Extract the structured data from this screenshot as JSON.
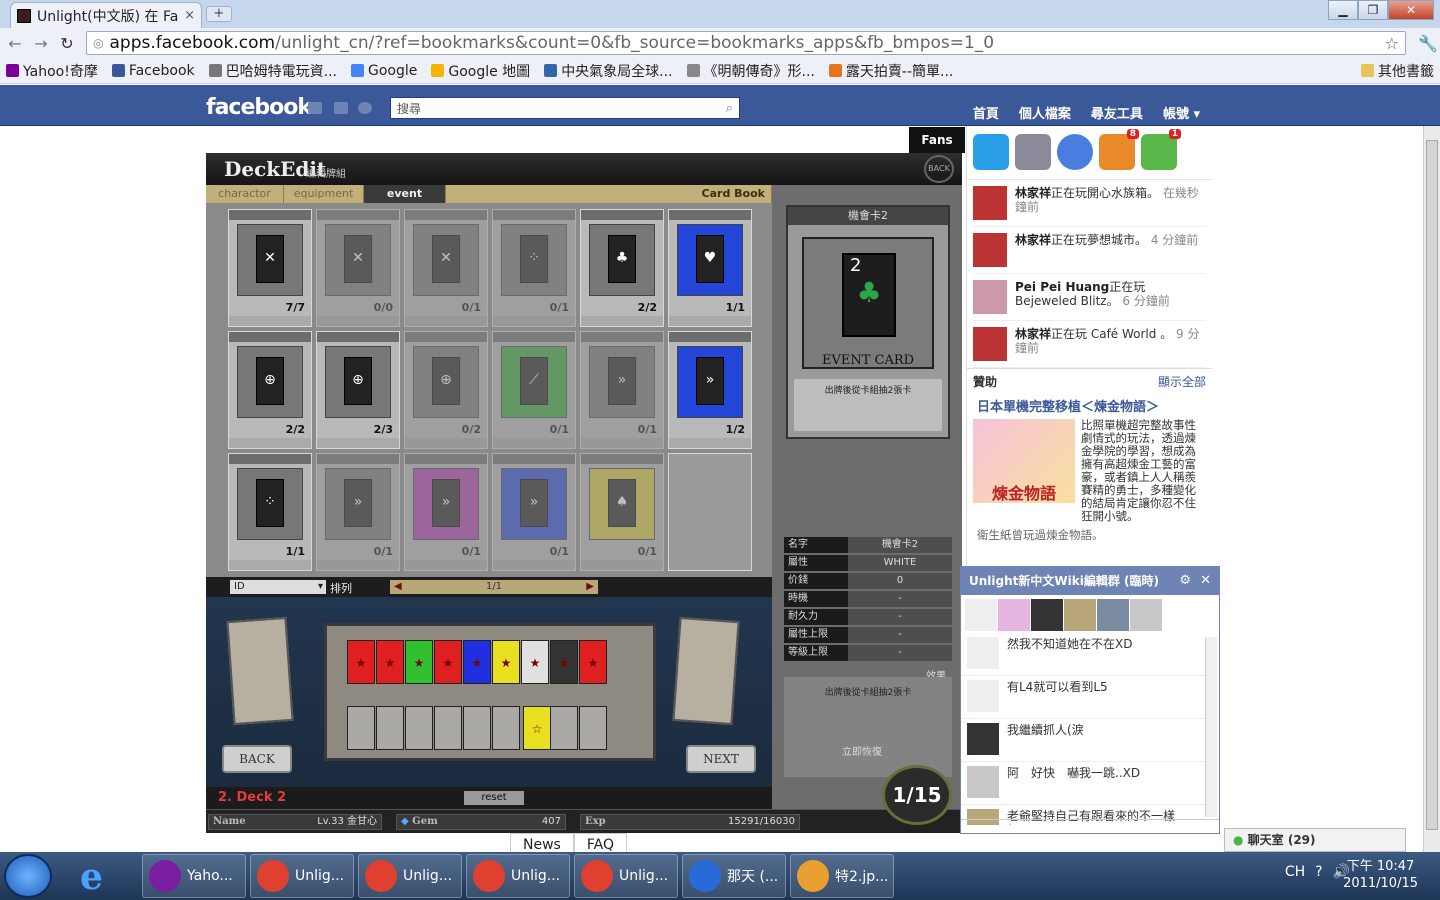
{
  "browser": {
    "tab_title": "Unlight(中文版) 在 Fa",
    "tab_close": "×",
    "new_tab": "+",
    "url_host": "apps.facebook.com",
    "url_path": "/unlight_cn/?ref=bookmarks&count=0&fb_source=bookmarks_apps&fb_bmpos=1_0",
    "win_min": "▁",
    "win_max": "❐",
    "win_close": "✕"
  },
  "bookmarks": [
    {
      "label": "Yahoo!奇摩",
      "color": "#7b0099"
    },
    {
      "label": "Facebook",
      "color": "#3b5998"
    },
    {
      "label": "巴哈姆特電玩資...",
      "color": "#777777"
    },
    {
      "label": "Google",
      "color": "#4285f4"
    },
    {
      "label": "Google 地圖",
      "color": "#f4b400"
    },
    {
      "label": "中央氣象局全球...",
      "color": "#3366aa"
    },
    {
      "label": "《明朝傳奇》形...",
      "color": "#888888"
    },
    {
      "label": "露天拍賣--簡單...",
      "color": "#e8731a"
    }
  ],
  "bookmarks_other": "其他書籤",
  "facebook": {
    "logo": "facebook",
    "search_placeholder": "搜尋",
    "nav": [
      "首頁",
      "個人檔案",
      "尋友工具",
      "帳號 ▾"
    ]
  },
  "game": {
    "header_title": "DeckEdit",
    "header_sub": "編輯牌組",
    "fans": "Fans",
    "back_icon_label": "BACK",
    "tabs": [
      "charactor",
      "equipment",
      "event"
    ],
    "card_book": "Card Book",
    "cards": [
      {
        "num": "7/7",
        "dim": false,
        "color": "#777777",
        "label": "✕"
      },
      {
        "num": "0/0",
        "dim": true,
        "color": "#777777",
        "label": "✕"
      },
      {
        "num": "0/1",
        "dim": true,
        "color": "#777777",
        "label": "✕"
      },
      {
        "num": "0/1",
        "dim": true,
        "color": "#777777",
        "label": "⁘"
      },
      {
        "num": "2/2",
        "dim": false,
        "color": "#777777",
        "label": "♣"
      },
      {
        "num": "1/1",
        "dim": false,
        "color": "#2446d8",
        "label": "♥"
      },
      {
        "num": "2/2",
        "dim": false,
        "color": "#777777",
        "label": "⊕"
      },
      {
        "num": "2/3",
        "dim": false,
        "color": "#777777",
        "label": "⊕"
      },
      {
        "num": "0/2",
        "dim": true,
        "color": "#777777",
        "label": "⊕"
      },
      {
        "num": "0/1",
        "dim": true,
        "color": "#3aa83a",
        "label": "⟋"
      },
      {
        "num": "0/1",
        "dim": true,
        "color": "#777777",
        "label": "»"
      },
      {
        "num": "1/2",
        "dim": false,
        "color": "#2446d8",
        "label": "»"
      },
      {
        "num": "1/1",
        "dim": false,
        "color": "#777777",
        "label": "⁘"
      },
      {
        "num": "0/1",
        "dim": true,
        "color": "#777777",
        "label": "»"
      },
      {
        "num": "0/1",
        "dim": true,
        "color": "#b33ab3",
        "label": "»"
      },
      {
        "num": "0/1",
        "dim": true,
        "color": "#2446d8",
        "label": "»"
      },
      {
        "num": "0/1",
        "dim": true,
        "color": "#d8c83a",
        "label": "♠"
      }
    ],
    "sort_value": "ID",
    "sort_label": "排列",
    "page": "1/1",
    "deck_slots": [
      {
        "color": "#e02020"
      },
      {
        "color": "#e02020"
      },
      {
        "color": "#30c030"
      },
      {
        "color": "#e02020"
      },
      {
        "color": "#2030e0"
      },
      {
        "color": "#e8e020"
      },
      {
        "color": "#e0e0e0"
      },
      {
        "color": "#333333"
      },
      {
        "color": "#e02020"
      }
    ],
    "back_btn": "BACK",
    "next_btn": "NEXT",
    "deck_name": "2.  Deck 2",
    "reset": "reset",
    "status": {
      "name_label": "Name",
      "name_value": "Lv.33 金甘心",
      "gem_label": "Gem",
      "gem_value": "407",
      "exp_label": "Exp",
      "exp_value": "15291/16030"
    },
    "detail": {
      "title": "機會卡2",
      "big_num": "2",
      "card_name": "EVENT CARD",
      "desc": "出牌後從卡組抽2張卡",
      "stats": [
        {
          "k": "名字",
          "v": "機會卡2"
        },
        {
          "k": "屬性",
          "v": "WHITE"
        },
        {
          "k": "价錢",
          "v": "0"
        },
        {
          "k": "時機",
          "v": "-"
        },
        {
          "k": "耐久力",
          "v": "-"
        },
        {
          "k": "屬性上限",
          "v": "-"
        },
        {
          "k": "等級上限",
          "v": "-"
        }
      ],
      "effect_label": "效果",
      "effect_text": "出牌後從卡組抽2張卡",
      "recover_label": "立即恢復",
      "deck_count": "1/15"
    }
  },
  "news_tabs": [
    "News",
    "FAQ"
  ],
  "ticker": [
    {
      "name": "林家祥",
      "text": "正在玩開心水族箱。",
      "time": "在幾秒鐘前"
    },
    {
      "name": "林家祥",
      "text": "正在玩夢想城市。",
      "time": "4 分鐘前"
    },
    {
      "name": "Pei Pei Huang",
      "text": "正在玩 Bejeweled Blitz。",
      "time": "6 分鐘前"
    },
    {
      "name": "林家祥",
      "text": "正在玩 Café World 。",
      "time": "9 分鐘前"
    }
  ],
  "apps_badges": [
    "8",
    "1"
  ],
  "sponsor": {
    "head": "贊助",
    "show_all": "顯示全部",
    "ad_title": "日本單機完整移植＜煉金物語＞",
    "ad_img_text": "煉金物語",
    "ad_text": "比照單機超完整故事性劇情式的玩法，透過煉金學院的學習，想成為擁有高超煉金工藝的富豪，或者鎮上人人稱羨賽精的勇士，多種變化的結局肯定讓你忍不住狂開小號。",
    "ad_foot": "衛生紙曾玩過煉金物語。"
  },
  "chat": {
    "title": "Unlight新中文Wiki編輯群 (臨時)",
    "messages": [
      "然我不知道她在不在XD",
      "有L4就可以看到L5",
      "我繼續抓人(淚",
      "阿　好快　嚇我一跳..XD",
      "老爺堅持自己有跟看來的不一樣(????"
    ],
    "bar_label": "聊天室 (29)"
  },
  "taskbar": {
    "buttons": [
      "Yaho...",
      "Unlig...",
      "Unlig...",
      "Unlig...",
      "Unlig...",
      "那天 (...",
      "特2.jp..."
    ],
    "lang": "CH",
    "time": "下午 10:47",
    "date": "2011/10/15"
  }
}
